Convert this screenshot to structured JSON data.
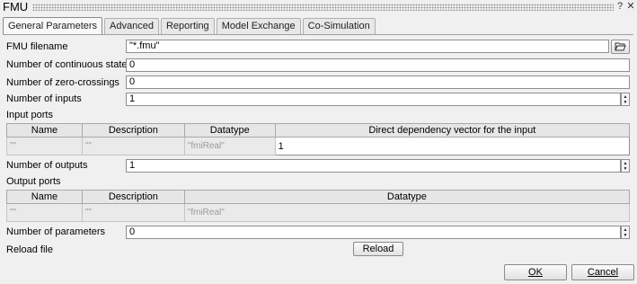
{
  "window": {
    "title": "FMU"
  },
  "tabs": [
    {
      "label": "General Parameters"
    },
    {
      "label": "Advanced"
    },
    {
      "label": "Reporting"
    },
    {
      "label": "Model Exchange"
    },
    {
      "label": "Co-Simulation"
    }
  ],
  "form": {
    "fmu_filename": {
      "label": "FMU filename",
      "value": "\"*.fmu\""
    },
    "num_continuous_states": {
      "label": "Number of continuous states",
      "value": "0"
    },
    "num_zero_crossings": {
      "label": "Number of zero-crossings",
      "value": "0"
    },
    "num_inputs": {
      "label": "Number of inputs",
      "value": "1"
    },
    "input_ports": {
      "label": "Input ports",
      "columns": [
        "Name",
        "Description",
        "Datatype",
        "Direct dependency vector for the input"
      ],
      "rows": [
        [
          "\"\"",
          "\"\"",
          "\"fmiReal\"",
          "1"
        ]
      ]
    },
    "num_outputs": {
      "label": "Number of outputs",
      "value": "1"
    },
    "output_ports": {
      "label": "Output ports",
      "columns": [
        "Name",
        "Description",
        "Datatype"
      ],
      "rows": [
        [
          "\"\"",
          "\"\"",
          "\"fmiReal\""
        ]
      ]
    },
    "num_parameters": {
      "label": "Number of parameters",
      "value": "0"
    },
    "reload_file": {
      "label": "Reload file",
      "button": "Reload"
    }
  },
  "footer": {
    "ok": "OK",
    "cancel": "Cancel"
  },
  "icons": {
    "help": "help-icon",
    "close": "close-icon",
    "folder": "folder-open-icon"
  }
}
